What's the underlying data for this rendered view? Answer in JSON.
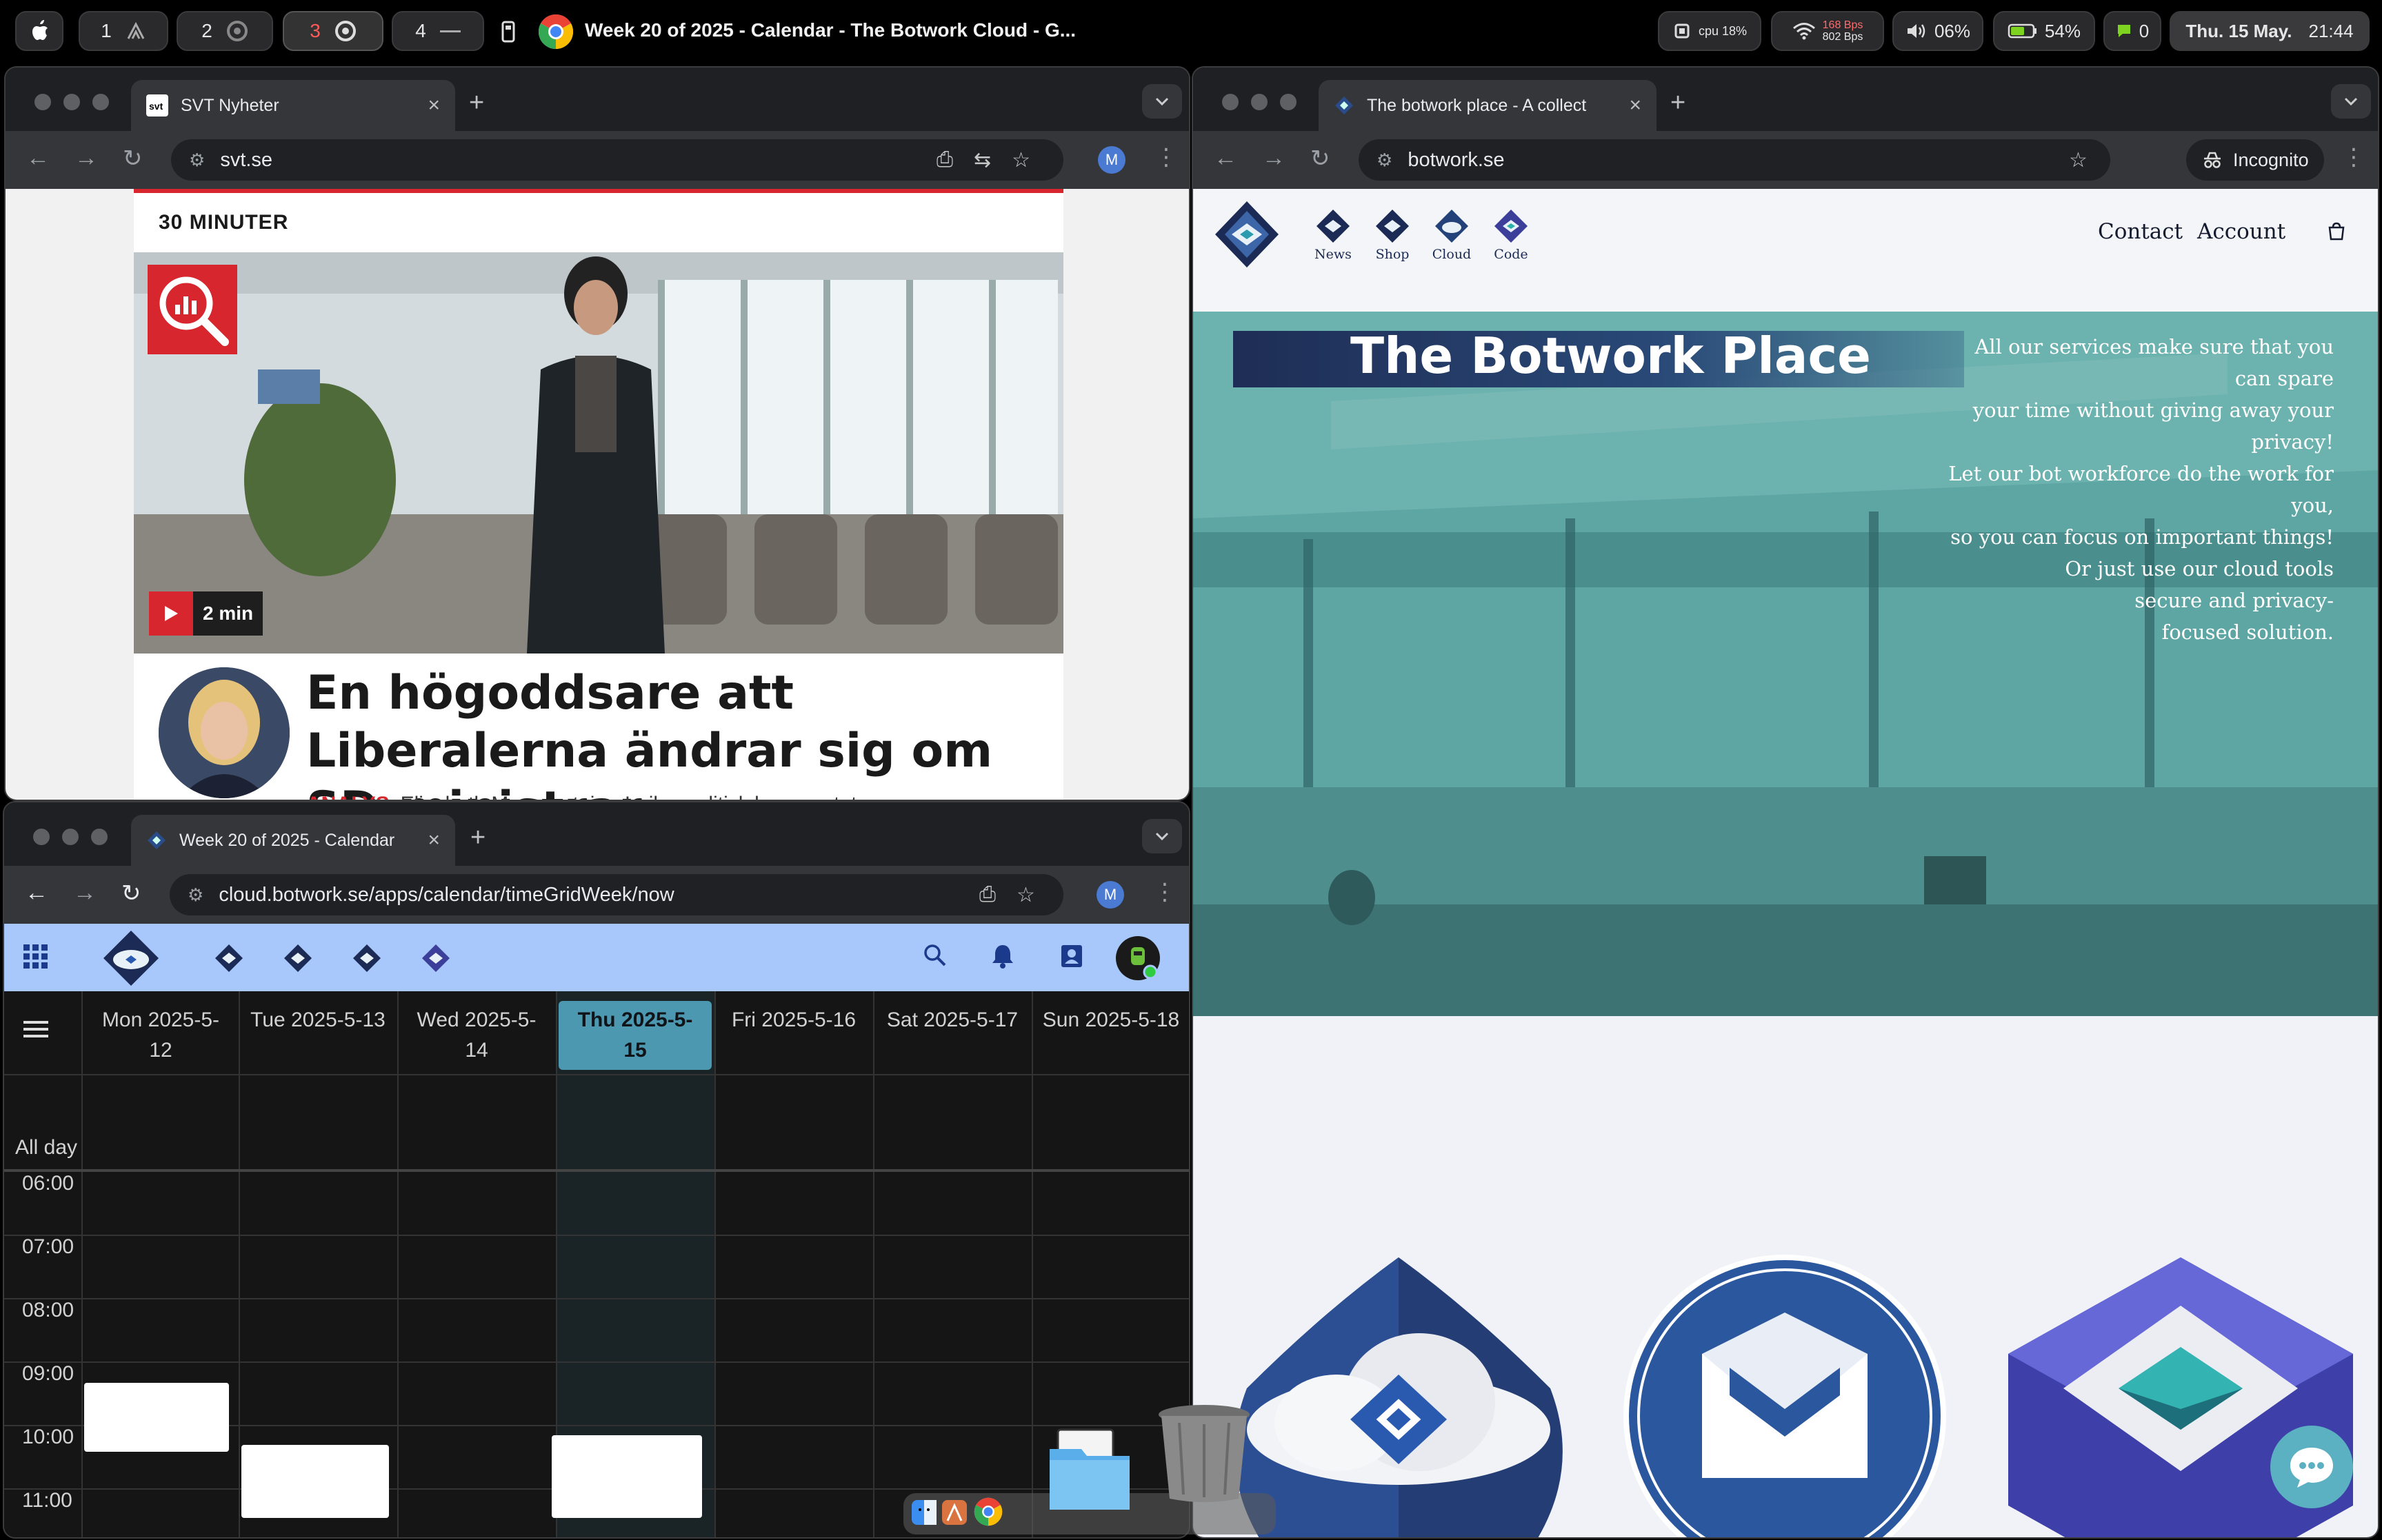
{
  "menubar": {
    "spaces": [
      {
        "label": "1",
        "icon": "claude-icon"
      },
      {
        "label": "2",
        "icon": "chrome-icon"
      },
      {
        "label": "3",
        "icon": "chrome-icon"
      },
      {
        "label": "4",
        "icon": "dash-icon"
      }
    ],
    "window_title": "Week 20 of 2025 - Calendar - The Botwork Cloud - G...",
    "cpu": "cpu 18%",
    "net_up": "168 Bps",
    "net_down": "802 Bps",
    "volume": "06%",
    "battery": "54%",
    "notifications": "0",
    "date": "Thu. 15 May.",
    "time": "21:44"
  },
  "svt": {
    "tab_title": "SVT Nyheter",
    "url": "svt.se",
    "kicker": "30 MINUTER",
    "duration": "2 min",
    "headline": "En högoddsare att Liberalerna ändrar sig om SD-ministrar",
    "byline_tag": "ANALYS",
    "byline": "Elisabeth Marmorstein · Inrikespolitisk kommentator"
  },
  "botwork": {
    "tab_title": "The botwork place - A collect",
    "url": "botwork.se",
    "incognito": "Incognito",
    "nav": [
      "News",
      "Shop",
      "Cloud",
      "Code"
    ],
    "contact": "Contact",
    "account": "Account",
    "title": "The Botwork Place",
    "tagline": [
      "All our services make sure that you",
      "can spare",
      "your time without giving away your",
      "privacy!",
      "Let our bot workforce do the work for",
      "you,",
      "so you can focus on important things!",
      "Or just use our cloud tools",
      "secure and privacy-",
      "focused solution."
    ]
  },
  "calendar": {
    "tab_title": "Week 20 of 2025 - Calendar",
    "url": "cloud.botwork.se/apps/calendar/timeGridWeek/now",
    "days": [
      {
        "line1": "Mon 2025-5-",
        "line2": "12"
      },
      {
        "line1": "Tue 2025-5-13",
        "line2": ""
      },
      {
        "line1": "Wed 2025-5-",
        "line2": "14"
      },
      {
        "line1": "Thu 2025-5-",
        "line2": "15"
      },
      {
        "line1": "Fri 2025-5-16",
        "line2": ""
      },
      {
        "line1": "Sat 2025-5-17",
        "line2": ""
      },
      {
        "line1": "Sun 2025-5-18",
        "line2": ""
      }
    ],
    "all_day": "All day",
    "hours": [
      "06:00",
      "07:00",
      "08:00",
      "09:00",
      "10:00",
      "11:00"
    ]
  },
  "colors": {
    "svt_red": "#d7262d",
    "botwork_navy": "#1e2d55",
    "botwork_teal": "#5fa8a5",
    "calendar_header": "#a8c7fa",
    "today_highlight": "#4c98b0"
  }
}
